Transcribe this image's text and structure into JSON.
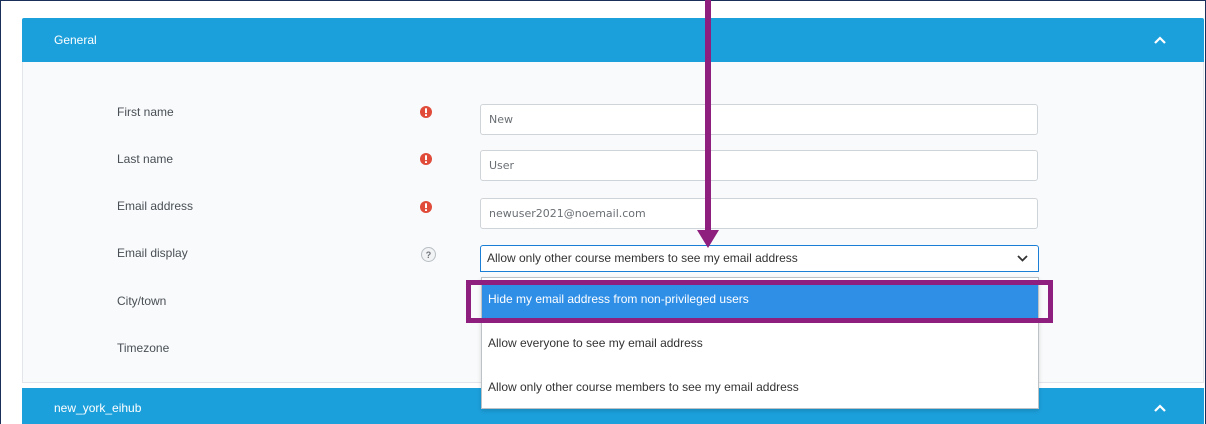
{
  "sections": {
    "general": {
      "title": "General"
    },
    "newyork": {
      "title": "new_york_eihub"
    }
  },
  "fields": [
    {
      "label": "First name",
      "value": "New",
      "required": true
    },
    {
      "label": "Last name",
      "value": "User",
      "required": true
    },
    {
      "label": "Email address",
      "value": "newuser2021@noemail.com",
      "required": true
    },
    {
      "label": "Email display",
      "value": "Allow only other course members to see my email address",
      "help": "?"
    },
    {
      "label": "City/town"
    },
    {
      "label": "Timezone"
    }
  ],
  "dropdown": {
    "options": [
      "Hide my email address from non-privileged users",
      "Allow everyone to see my email address",
      "Allow only other course members to see my email address"
    ],
    "highlighted_index": 0
  },
  "colors": {
    "header": "#1ca0dc",
    "annotation": "#8e1f7e",
    "required": "#e04b3a",
    "selected_option": "#2f8fe7"
  }
}
